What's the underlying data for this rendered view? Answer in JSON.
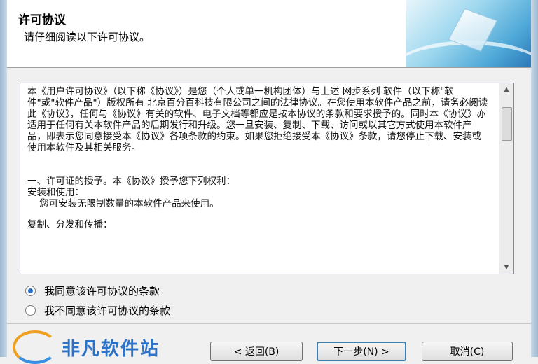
{
  "header": {
    "title": "许可协议",
    "subtitle": "请仔细阅读以下许可协议。"
  },
  "license": {
    "paragraphs": [
      "本《用户许可协议》（以下称《协议》）是您（个人或单一机构团体）与上述 网步系列 软件（以下称\"软件\"或\"软件产品\"）版权所有 北京百分百科技有限公司之间的法律协议。在您使用本软件产品之前，请务必阅读此《协议》，任何与《协议》有关的软件、电子文档等都应是按本协议的条款和要求授予的。同时本《协议》亦适用于任何有关本软件产品的后期发行和升级。您一旦安装、复制、下载、访问或以其它方式使用本软件产品，即表示您同意接受本《协议》各项条款的约束。如果您拒绝接受本《协议》条款，请您停止下载、安装或使用本软件及其相关服务。",
      "一、许可证的授予。本《协议》授予您下列权利：\n安装和使用：\n    您可安装无限制数量的本软件产品来使用。",
      "复制、分发和传播："
    ]
  },
  "options": {
    "accept": "我同意该许可协议的条款",
    "decline": "我不同意该许可协议的条款",
    "selected": "accept"
  },
  "footer": {
    "logo_text": "非凡软件站"
  },
  "buttons": {
    "back": "< 返回(B)",
    "next": "下一步(N) >",
    "cancel": "取消(C)"
  }
}
